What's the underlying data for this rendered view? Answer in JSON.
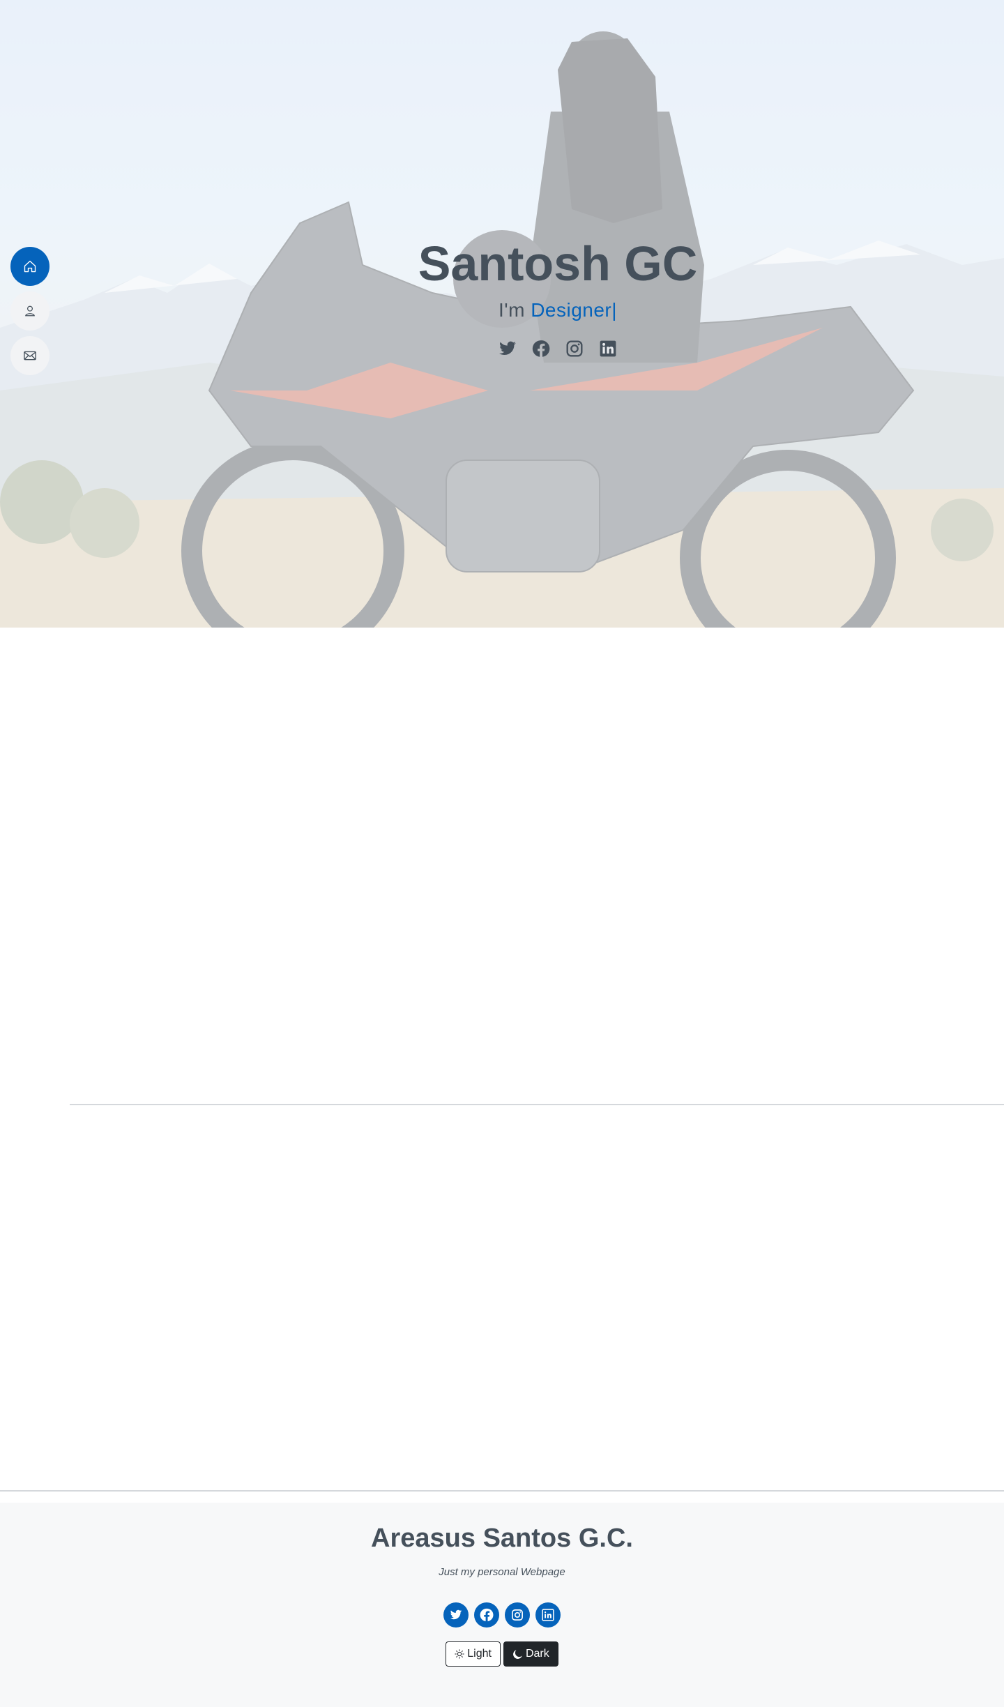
{
  "hero": {
    "title": "Santosh GC",
    "subtitle_prefix": "I'm ",
    "subtitle_typed": "Designer",
    "subtitle_cursor": "|",
    "social": [
      "twitter-icon",
      "facebook-icon",
      "instagram-icon",
      "linkedin-icon"
    ]
  },
  "sidenav": {
    "items": [
      {
        "name": "home",
        "icon": "house-icon",
        "active": true
      },
      {
        "name": "about",
        "icon": "person-icon",
        "active": false
      },
      {
        "name": "contact",
        "icon": "envelope-icon",
        "active": false
      }
    ]
  },
  "footer": {
    "title": "Areasus Santos G.C.",
    "tagline": "Just my personal Webpage",
    "social": [
      "twitter-icon",
      "facebook-icon",
      "instagram-icon",
      "linkedin-icon"
    ],
    "theme": {
      "light_label": "Light",
      "dark_label": "Dark"
    }
  },
  "colors": {
    "accent": "#0563bb",
    "text": "#45505b",
    "footer_bg": "#f7f8f9",
    "dark_button": "#212529"
  }
}
